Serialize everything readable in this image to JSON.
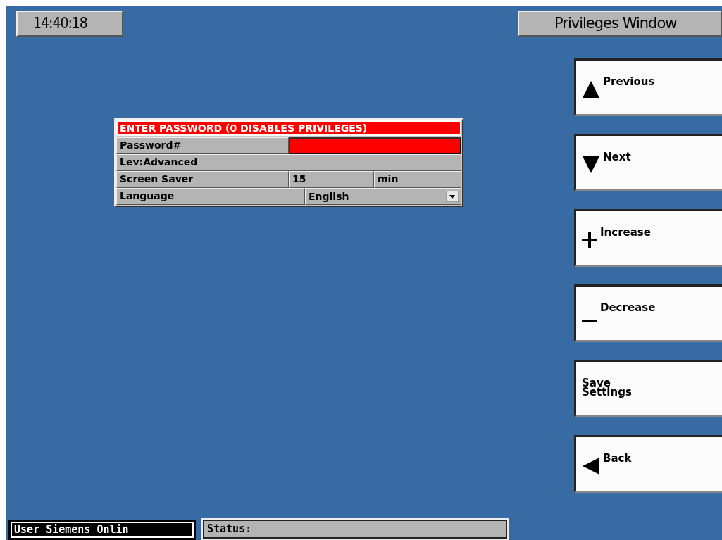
{
  "clock": "14:40:18",
  "title": "Privileges Window",
  "panel": {
    "heading": "ENTER PASSWORD (0 DISABLES PRIVILEGES)",
    "rows": [
      {
        "kind": "field",
        "label": "Password#",
        "active": true
      },
      {
        "kind": "text",
        "label": "Lev:Advanced"
      },
      {
        "kind": "value_unit",
        "label": "Screen Saver",
        "value": "15",
        "unit": "min"
      },
      {
        "kind": "dropdown",
        "label": "Language",
        "value": "English"
      }
    ]
  },
  "buttons": [
    {
      "kind": "up",
      "label": "Previous"
    },
    {
      "kind": "down",
      "label": "Next"
    },
    {
      "kind": "plus",
      "label": "Increase"
    },
    {
      "kind": "minus",
      "label": "Decrease"
    },
    {
      "kind": "plain",
      "label": "Save\nSettings"
    },
    {
      "kind": "left",
      "label": "Back"
    }
  ],
  "status_bar": {
    "user": "User Siemens Onlin",
    "status": "Status:"
  }
}
